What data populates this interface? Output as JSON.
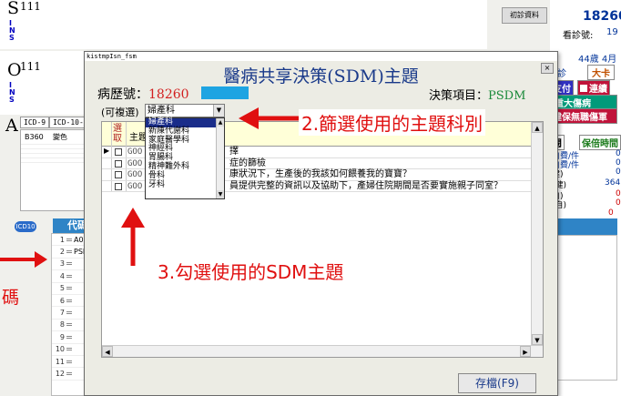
{
  "background": {
    "patient_letter_1": "S",
    "sup_1": "111",
    "patient_letter_2": "O",
    "sup_2": "111",
    "vertical_label": [
      "I",
      "N",
      "S"
    ],
    "icd_prefix": "A",
    "icd_tabs": [
      "ICD-9",
      "ICD-10-"
    ],
    "icd_rows": [
      "B360",
      "變色"
    ],
    "first_visit_button": "初診資料",
    "patient_number": "18260",
    "visit_number_label": "看診號:",
    "visit_number": "19",
    "age_text": "44歲 4月",
    "doctor_label": "診",
    "card_label": "大卡",
    "payment_label": "支付",
    "chronic_label": "連續",
    "major_illness_label": "重大傷病",
    "no_insurance_label": "健保無職傷軍",
    "stat_labels": [
      "閱",
      "保倍時間",
      "自費/件",
      "自費/件",
      "健)",
      "(健)",
      "自)",
      "(自)"
    ],
    "stat_values": [
      "0",
      "0",
      "0",
      "364",
      "0",
      "0",
      "0"
    ],
    "icd_badge": "ICD10",
    "code_header": "代碼",
    "code_rows": [
      {
        "n": "1",
        "code": "A08"
      },
      {
        "n": "2",
        "code": "PSD"
      },
      {
        "n": "3",
        "code": ""
      },
      {
        "n": "4",
        "code": ""
      },
      {
        "n": "5",
        "code": ""
      },
      {
        "n": "6",
        "code": ""
      },
      {
        "n": "7",
        "code": ""
      },
      {
        "n": "8",
        "code": ""
      },
      {
        "n": "9",
        "code": ""
      },
      {
        "n": "10",
        "code": ""
      },
      {
        "n": "11",
        "code": ""
      },
      {
        "n": "12",
        "code": ""
      }
    ],
    "left_annotation": "碼"
  },
  "dialog": {
    "window_title": "kistmpIsn_fsm",
    "heading": "醫病共享決策(SDM)主題",
    "close_glyph": "×",
    "record_label": "病歷號：",
    "record_number": "18260",
    "topic_label": "決策項目：",
    "topic_value": "PSDM",
    "multi_label": "(可複選)",
    "dropdown_value": "婦產科",
    "dropdown_options": [
      "婦產科",
      "新陳代謝科",
      "家庭醫學科",
      "神經科",
      "胃腸科",
      "精神難外科",
      "骨科",
      "牙科"
    ],
    "grid_header_check": "選取",
    "grid_header_topic": "主題",
    "rows": [
      {
        "code": "GOO",
        "text": "擇"
      },
      {
        "code": "GOO",
        "text": "症的篩檢"
      },
      {
        "code": "GOO",
        "text": "康狀況下，生產後的我該如何餵養我的寶寶？"
      },
      {
        "code": "GOO",
        "text": "員提供完整的資訊以及協助下，產婦住院期間是否要實施親子同室？"
      }
    ],
    "save_button": "存檔(F9)"
  },
  "annotations": {
    "step2": "2.篩選使用的主題科別",
    "step3": "3.勾選使用的SDM主題"
  },
  "colors": {
    "annotation_red": "#e01010",
    "accent_blue": "#1ea4e2",
    "header_yellow": "#ffffd8"
  }
}
